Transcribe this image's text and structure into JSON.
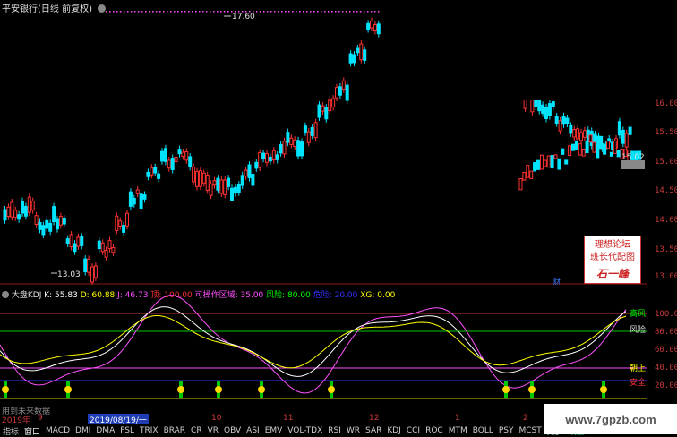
{
  "window": {
    "title": "平安银行(日线 前复权)",
    "title_icon": "circle-arrow-icon"
  },
  "price_chart": {
    "high_label": "17.60",
    "low_label": "13.03",
    "current_price_tag": "15.02",
    "axis_ticks": [
      "16.00",
      "15.50",
      "15.00",
      "14.50",
      "14.00",
      "13.50",
      "13.00"
    ],
    "fin_marker": "财",
    "colors": {
      "up": "#ff3232",
      "down": "#00e5ff",
      "ma": "#ff50ff"
    }
  },
  "indicator": {
    "name": "大盘KDJ",
    "params": [
      {
        "label": "K: 55.83",
        "color": "#ffffff"
      },
      {
        "label": "D: 60.88",
        "color": "#ffff00"
      },
      {
        "label": "J: 46.73",
        "color": "#ff50ff"
      },
      {
        "label": "顶: 100.00",
        "color": "#ff3232"
      },
      {
        "label": "可操作区域: 35.00",
        "color": "#ff50ff"
      },
      {
        "label": "风险: 80.00",
        "color": "#00ff00"
      },
      {
        "label": "危险: 20.00",
        "color": "#3232ff"
      },
      {
        "label": "XG: 0.00",
        "color": "#ffff00"
      }
    ],
    "axis_ticks": [
      "100.0",
      "80.00",
      "60.00",
      "40.00",
      "20.00"
    ],
    "zone_labels": {
      "top": "高风",
      "risk": "风险",
      "up": "朝上",
      "safe": "安全"
    }
  },
  "date_bar": {
    "left_label": "2019年",
    "selected_date": "2019/08/19/一",
    "month_ticks": [
      "9",
      "10",
      "11",
      "12",
      "1",
      "2"
    ],
    "future_label": "用到未来数据"
  },
  "tabs": [
    "指标",
    "窗口",
    "MACD",
    "DMI",
    "DMA",
    "FSL",
    "TRIX",
    "BRAR",
    "CR",
    "VR",
    "OBV",
    "ASI",
    "EMV",
    "VOL-TDX",
    "RSI",
    "WR",
    "SAR",
    "KDJ",
    "CCI",
    "ROC",
    "MTM",
    "BOLL",
    "PSY",
    "MCST",
    "更多",
    "设置"
  ],
  "watermark": {
    "line1": "理想论坛",
    "line2": "班长代配图",
    "signature": "石一峰"
  },
  "site_mark": "www.7gpzb.com",
  "chart_data": {
    "type": "candlestick",
    "title": "平安银行(日线 前复权)",
    "ylim": [
      12.9,
      17.8
    ],
    "high": 17.6,
    "low": 13.03,
    "last": 15.02
  }
}
